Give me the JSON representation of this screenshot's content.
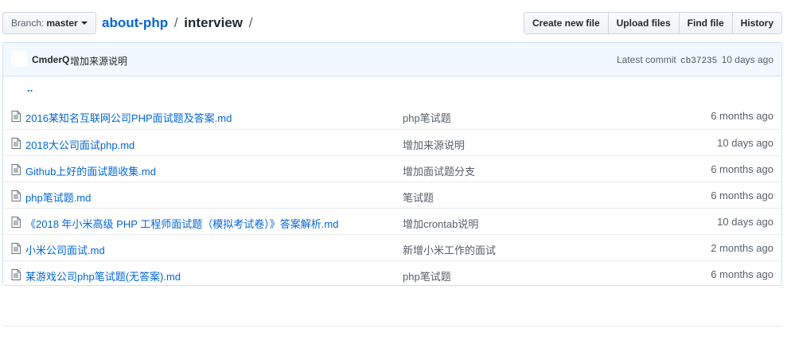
{
  "branch": {
    "label": "Branch:",
    "value": "master"
  },
  "breadcrumb": {
    "repo": "about-php",
    "separator1": "/",
    "folder": "interview",
    "separator2": "/"
  },
  "actions": [
    {
      "label": "Create new file"
    },
    {
      "label": "Upload files"
    },
    {
      "label": "Find file"
    },
    {
      "label": "History"
    }
  ],
  "commit": {
    "author": "CmderQ",
    "message": "增加来源说明",
    "prefix": "Latest commit",
    "sha": "cb37235",
    "age": "10 days ago"
  },
  "parent_link": "..",
  "files": [
    {
      "name": "2016某知名互联网公司PHP面试题及答案.md",
      "message": "php笔试题",
      "age": "6 months ago"
    },
    {
      "name": "2018大公司面试php.md",
      "message": "增加来源说明",
      "age": "10 days ago"
    },
    {
      "name": "Github上好的面试题收集.md",
      "message": "增加面试题分支",
      "age": "6 months ago"
    },
    {
      "name": "php笔试题.md",
      "message": "笔试题",
      "age": "6 months ago"
    },
    {
      "name": "《2018 年小米高级 PHP 工程师面试题（模拟考试卷）》答案解析.md",
      "message": "增加crontab说明",
      "age": "10 days ago"
    },
    {
      "name": "小米公司面试.md",
      "message": "新增小米工作的面试",
      "age": "2 months ago"
    },
    {
      "name": "某游戏公司php笔试题(无答案).md",
      "message": "php笔试题",
      "age": "6 months ago"
    }
  ]
}
